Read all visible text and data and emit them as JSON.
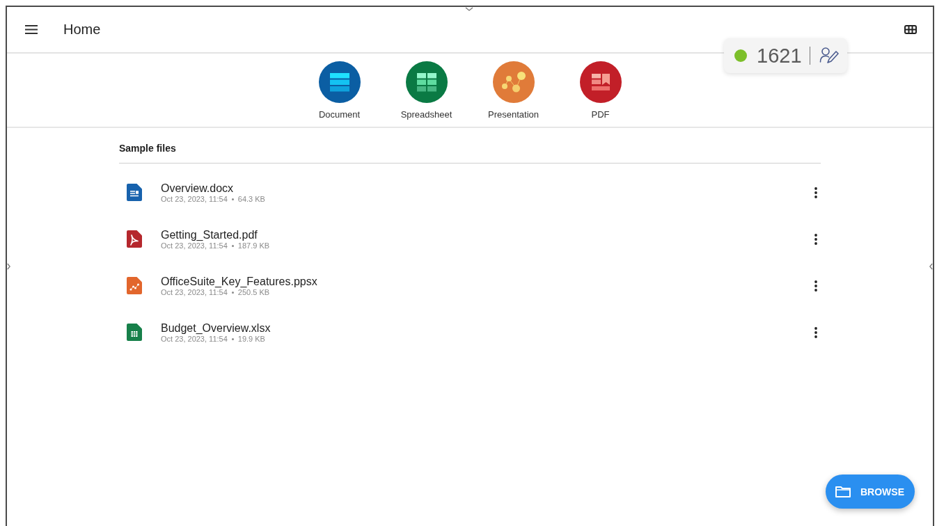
{
  "header": {
    "title": "Home"
  },
  "status_badge": {
    "online": true,
    "count": "1621"
  },
  "create_items": [
    {
      "kind": "document",
      "label": "Document"
    },
    {
      "kind": "spreadsheet",
      "label": "Spreadsheet"
    },
    {
      "kind": "presentation",
      "label": "Presentation"
    },
    {
      "kind": "pdf",
      "label": "PDF"
    }
  ],
  "sample_files": {
    "title": "Sample files",
    "files": [
      {
        "kind": "document",
        "name": "Overview.docx",
        "date": "Oct 23, 2023, 11:54",
        "size": "64.3 KB"
      },
      {
        "kind": "pdf",
        "name": "Getting_Started.pdf",
        "date": "Oct 23, 2023, 11:54",
        "size": "187.9 KB"
      },
      {
        "kind": "presentation",
        "name": "OfficeSuite_Key_Features.ppsx",
        "date": "Oct 23, 2023, 11:54",
        "size": "250.5 KB"
      },
      {
        "kind": "spreadsheet",
        "name": "Budget_Overview.xlsx",
        "date": "Oct 23, 2023, 11:54",
        "size": "19.9 KB"
      }
    ]
  },
  "browse_button": {
    "label": "BROWSE"
  }
}
